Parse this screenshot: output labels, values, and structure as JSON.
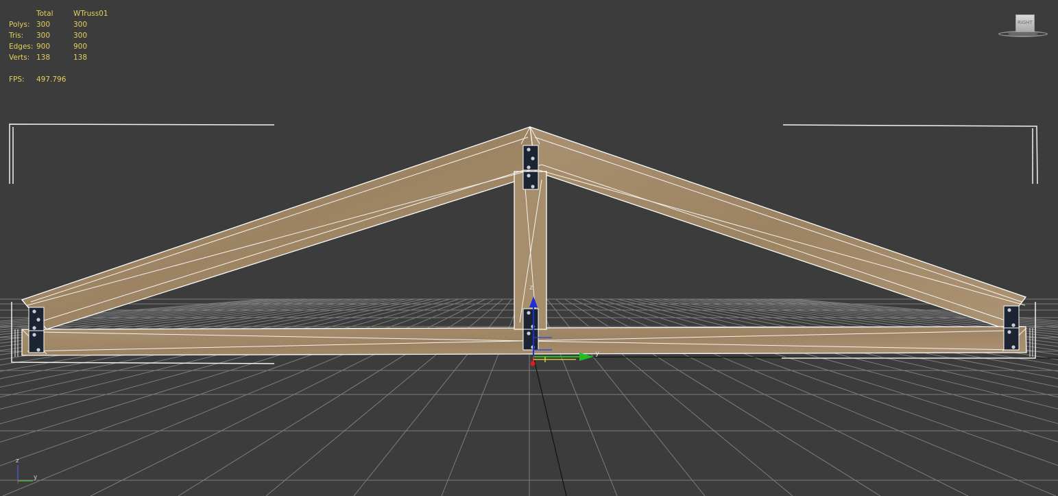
{
  "stats": {
    "headers": {
      "total": "Total",
      "object": "WTruss01"
    },
    "rows": [
      {
        "label": "Polys:",
        "total": "300",
        "object": "300"
      },
      {
        "label": "Tris:",
        "total": "300",
        "object": "300"
      },
      {
        "label": "Edges:",
        "total": "900",
        "object": "900"
      },
      {
        "label": "Verts:",
        "total": "138",
        "object": "138"
      }
    ],
    "fps": {
      "label": "FPS:",
      "value": "497.796"
    }
  },
  "viewcube": {
    "label": "RIGHT"
  },
  "gizmo": {
    "z": "z",
    "y": "y"
  },
  "axis_tripod": {
    "z": "z",
    "y": "y"
  },
  "colors": {
    "viewport_bg": "#3c3c3c",
    "grid": "#7d7d7d",
    "stats_text": "#e6d15a",
    "wood": "#a58c6a",
    "wireframe": "#ffffff",
    "gizmo_z": "#1f2fd6",
    "gizmo_y": "#1fbf1f",
    "gizmo_x": "#d92020"
  }
}
